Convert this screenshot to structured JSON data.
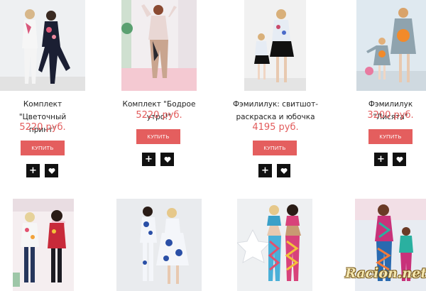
{
  "products": [
    {
      "title_line1": "Комплект \"Цветочный",
      "title_line2": "принт\"",
      "price": "5220 руб.",
      "buy_label": "купить"
    },
    {
      "title_line1": "Комплект \"Бодрое утро!\"",
      "title_line2": "",
      "price": "5220 руб.",
      "buy_label": "купить"
    },
    {
      "title_line1": "Фэмилилук: свитшот-",
      "title_line2": "раскраска и юбочка",
      "price": "4195 руб.",
      "buy_label": "купить"
    },
    {
      "title_line1": "Фэмилилук \"Лисята\"",
      "title_line2": "",
      "price": "3200 руб.",
      "buy_label": "купить"
    }
  ],
  "icons": {
    "add": "plus-icon",
    "favorite": "heart-icon"
  },
  "watermark": "Racion.net",
  "colors": {
    "accent": "#e45e5e",
    "price": "#e25b5b",
    "icon_button": "#111111"
  }
}
